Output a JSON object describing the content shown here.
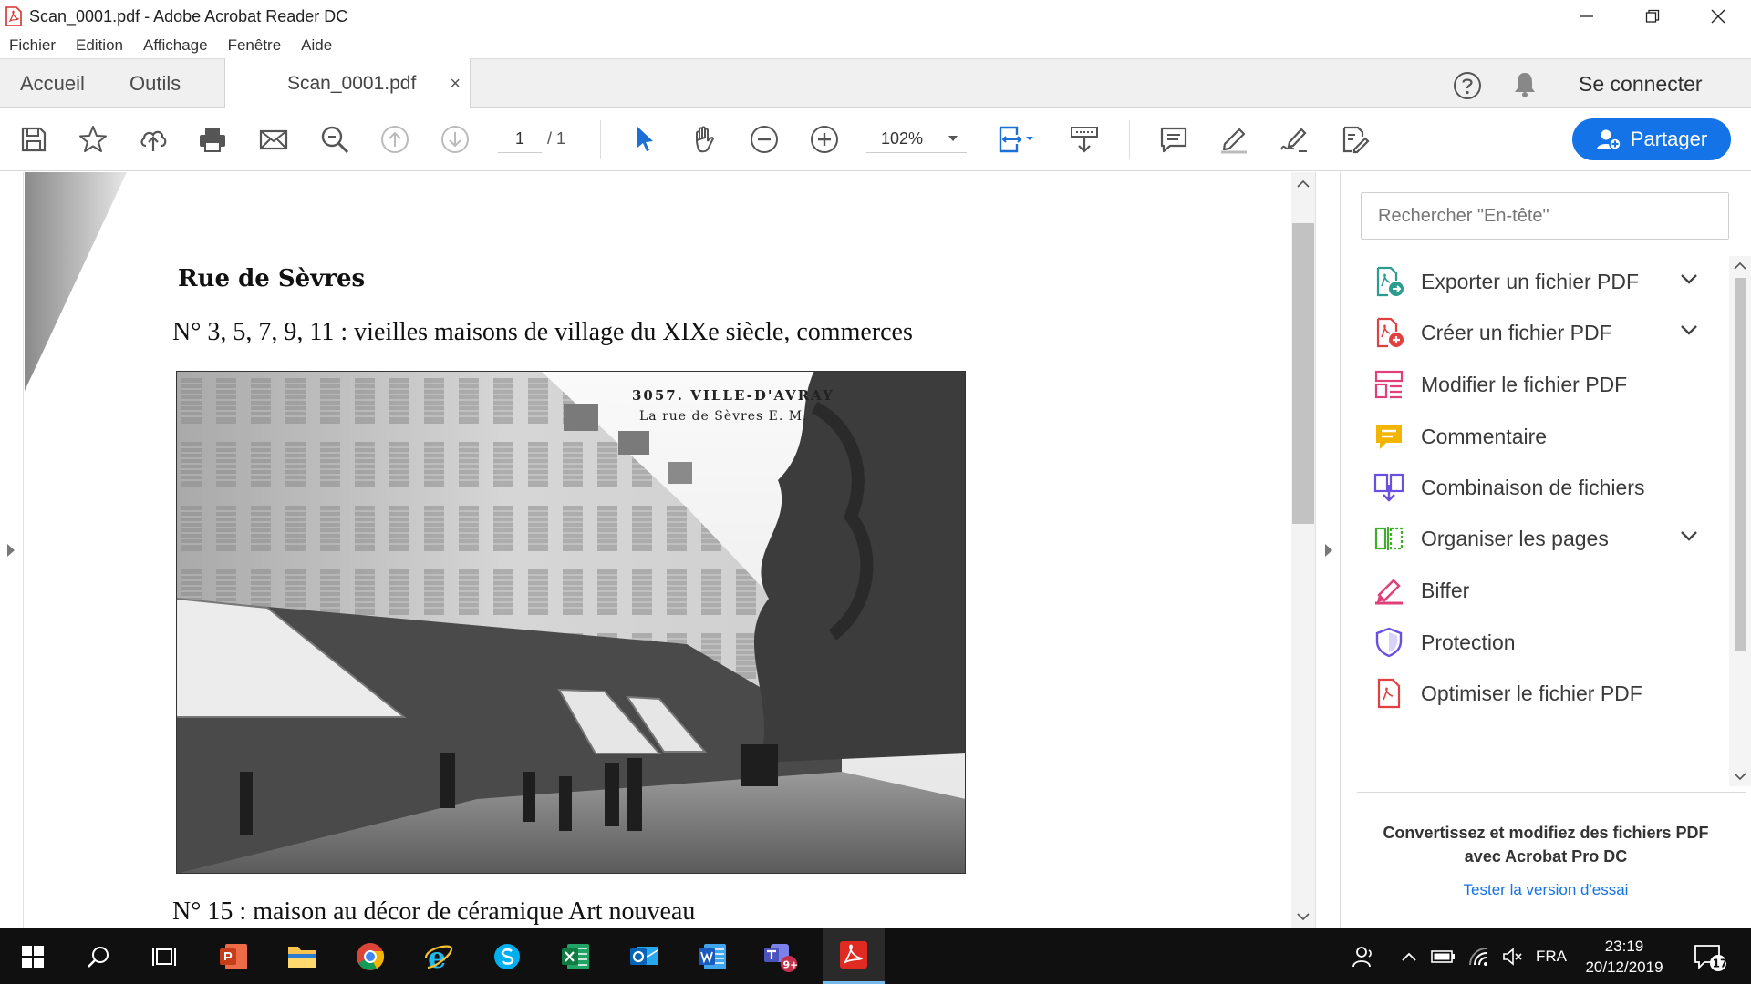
{
  "window": {
    "title": "Scan_0001.pdf - Adobe Acrobat Reader DC"
  },
  "menu": [
    "Fichier",
    "Edition",
    "Affichage",
    "Fenêtre",
    "Aide"
  ],
  "tabs": {
    "home": "Accueil",
    "tools": "Outils",
    "document": "Scan_0001.pdf",
    "close_glyph": "×",
    "sign_in": "Se connecter"
  },
  "toolbar": {
    "page_current": "1",
    "page_total": "/ 1",
    "zoom": "102%",
    "share": "Partager"
  },
  "document": {
    "heading": "Rue de Sèvres",
    "line1": "N° 3, 5, 7, 9, 11 : vieilles maisons de village du XIXe siècle, commerces",
    "caption_line1": "3057. VILLE-D'AVRAY",
    "caption_line2": "La rue de Sèvres E. M.",
    "line2": "N° 15 : maison au décor de céramique Art nouveau"
  },
  "tools_pane": {
    "search_placeholder": "Rechercher \"En-tête\"",
    "items": [
      {
        "label": "Exporter un fichier PDF",
        "icon": "export-pdf-icon",
        "expandable": true
      },
      {
        "label": "Créer un fichier PDF",
        "icon": "create-pdf-icon",
        "expandable": true
      },
      {
        "label": "Modifier le fichier PDF",
        "icon": "edit-pdf-icon",
        "expandable": false
      },
      {
        "label": "Commentaire",
        "icon": "comment-icon",
        "expandable": false
      },
      {
        "label": "Combinaison de fichiers",
        "icon": "combine-files-icon",
        "expandable": false
      },
      {
        "label": "Organiser les pages",
        "icon": "organize-pages-icon",
        "expandable": true
      },
      {
        "label": "Biffer",
        "icon": "redact-icon",
        "expandable": false
      },
      {
        "label": "Protection",
        "icon": "shield-icon",
        "expandable": false
      },
      {
        "label": "Optimiser le fichier PDF",
        "icon": "optimize-pdf-icon",
        "expandable": false
      }
    ],
    "promo_line1": "Convertissez et modifiez des fichiers PDF",
    "promo_line2": "avec Acrobat Pro DC",
    "trial_link": "Tester la version d'essai"
  },
  "taskbar": {
    "language": "FRA",
    "time": "23:19",
    "date": "20/12/2019",
    "notification_count": "17",
    "teams_badge": "9+"
  },
  "colors": {
    "accent": "#1473e6",
    "pdf_red": "#e02b22",
    "taskbar": "#101010"
  }
}
